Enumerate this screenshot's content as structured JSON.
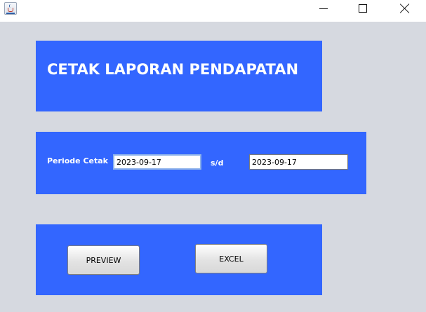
{
  "window": {
    "icon": "java-cup-icon",
    "controls": {
      "minimize": "minimize-icon",
      "maximize": "maximize-icon",
      "close": "close-icon"
    }
  },
  "header": {
    "title": "CETAK LAPORAN PENDAPATAN"
  },
  "period": {
    "label": "Periode Cetak",
    "separator": "s/d",
    "from_value": "2023-09-17",
    "to_value": "2023-09-17"
  },
  "actions": {
    "preview_label": "PREVIEW",
    "excel_label": "EXCEL"
  },
  "colors": {
    "panel": "#3366ff",
    "background": "#d6d9e0",
    "text_on_panel": "#ffffff"
  }
}
